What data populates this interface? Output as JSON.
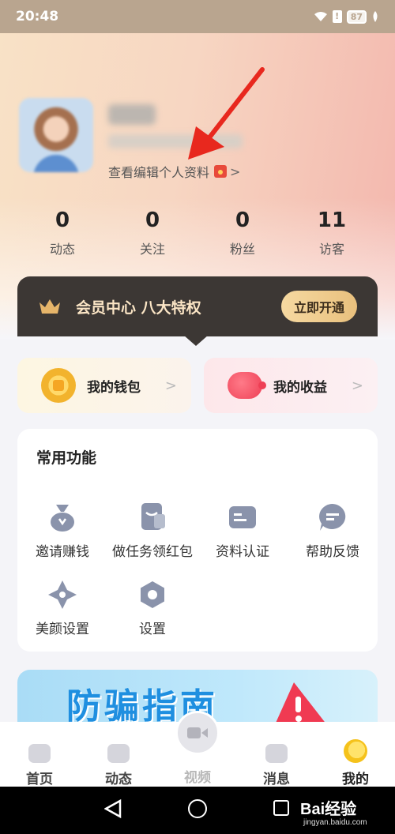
{
  "status_bar": {
    "time": "20:48",
    "battery": "87"
  },
  "profile": {
    "edit_link": "查看编辑个人资料",
    "edit_chevron": ">"
  },
  "stats": [
    {
      "value": "0",
      "label": "动态"
    },
    {
      "value": "0",
      "label": "关注"
    },
    {
      "value": "0",
      "label": "粉丝"
    },
    {
      "value": "11",
      "label": "访客"
    }
  ],
  "vip": {
    "title": "会员中心 八大特权",
    "button": "立即开通"
  },
  "cards": {
    "wallet": "我的钱包",
    "earnings": "我的收益",
    "chevron": ">"
  },
  "functions": {
    "title": "常用功能",
    "items": [
      "邀请赚钱",
      "做任务领红包",
      "资料认证",
      "帮助反馈",
      "美颜设置",
      "设置"
    ]
  },
  "banner": {
    "text": "防骗指南"
  },
  "tabs": [
    {
      "label": "首页"
    },
    {
      "label": "动态"
    },
    {
      "label": "视频"
    },
    {
      "label": "消息"
    },
    {
      "label": "我的"
    }
  ],
  "watermark": {
    "brand": "Bai经验",
    "url": "jingyan.baidu.com"
  },
  "colors": {
    "accent_gold": "#e9c07d",
    "vip_dark": "#3c3734",
    "banner_blue": "#1f8fe0",
    "annotation_red": "#e8281e"
  }
}
